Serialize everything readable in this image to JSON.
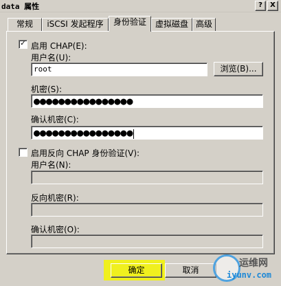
{
  "window": {
    "title": "data 属性",
    "help_btn": "?",
    "close_btn": "X"
  },
  "tabs": [
    {
      "label": "常规"
    },
    {
      "label": "iSCSI 发起程序"
    },
    {
      "label": "身份验证"
    },
    {
      "label": "虚拟磁盘"
    },
    {
      "label": "高级"
    }
  ],
  "chap": {
    "enable_label": "启用 CHAP(E):",
    "checked_mark": "✓",
    "username_label": "用户名(U):",
    "username_value": "root",
    "browse_label": "浏览(B)...",
    "secret_label": "机密(S):",
    "secret_value": "●●●●●●●●●●●●●●●●",
    "confirm_label": "确认机密(C):",
    "confirm_value": "●●●●●●●●●●●●●●●●"
  },
  "reverse_chap": {
    "enable_label": "启用反向 CHAP 身份验证(V):",
    "username_label": "用户名(N):",
    "secret_label": "反向机密(R):",
    "confirm_label": "确认机密(O):"
  },
  "footer": {
    "ok_label": "确定",
    "cancel_label": "取消"
  },
  "watermark": {
    "line1": "运维网",
    "line2": "iyunv.com"
  },
  "colors": {
    "highlight": "#f0f01e",
    "dialog_bg": "#d4d0c8"
  }
}
